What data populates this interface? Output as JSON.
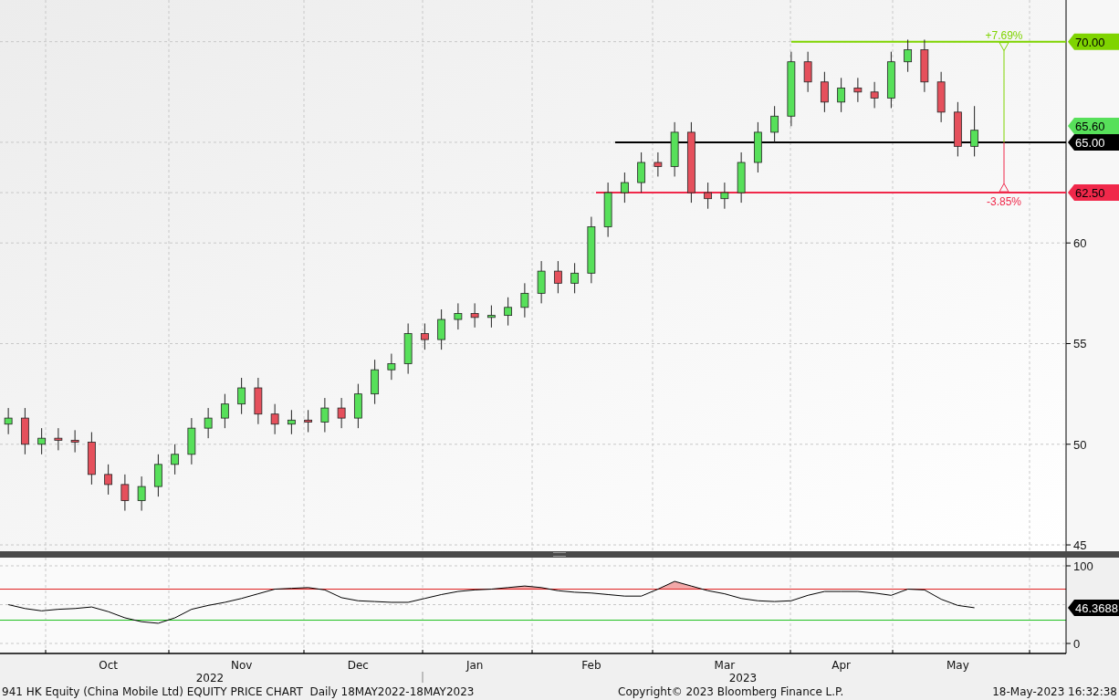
{
  "price_chart": {
    "chart_data": {
      "type": "candlestick",
      "ylim": [
        44.64,
        72.07
      ],
      "grid": true,
      "yticks": [
        45,
        50,
        55,
        60
      ],
      "categories": [
        null,
        null,
        null,
        null,
        null,
        null,
        null,
        null,
        null,
        null,
        null,
        null,
        null,
        null,
        null,
        null,
        null,
        null,
        null,
        null,
        null,
        null,
        null,
        null,
        null,
        null,
        null,
        null,
        null,
        null,
        null,
        null,
        null,
        null,
        null,
        null,
        null,
        null,
        null,
        null,
        null,
        null,
        null,
        null,
        null,
        null,
        null,
        null,
        null,
        null,
        null,
        null,
        null,
        null,
        null,
        null,
        null,
        null,
        null,
        null,
        null,
        null,
        null,
        null
      ],
      "ohlc": [
        [
          51,
          51.8,
          50.5,
          51.3
        ],
        [
          51.3,
          51.8,
          49.5,
          50
        ],
        [
          50,
          50.8,
          49.5,
          50.3
        ],
        [
          50.3,
          50.8,
          49.7,
          50.2
        ],
        [
          50.2,
          50.7,
          49.6,
          50.1
        ],
        [
          50.1,
          50.6,
          48,
          48.5
        ],
        [
          48.5,
          49,
          47.5,
          48
        ],
        [
          48,
          48.5,
          46.7,
          47.2
        ],
        [
          47.2,
          48.4,
          46.7,
          47.9
        ],
        [
          47.9,
          49.5,
          47.4,
          49
        ],
        [
          49,
          50,
          48.5,
          49.5
        ],
        [
          49.5,
          51.3,
          49,
          50.8
        ],
        [
          50.8,
          51.8,
          50.3,
          51.3
        ],
        [
          51.3,
          52.5,
          50.8,
          52
        ],
        [
          52,
          53.3,
          51.5,
          52.8
        ],
        [
          52.8,
          53.3,
          51,
          51.5
        ],
        [
          51.5,
          52,
          50.5,
          51
        ],
        [
          51,
          51.7,
          50.5,
          51.2
        ],
        [
          51.2,
          51.7,
          50.6,
          51.1
        ],
        [
          51.1,
          52.3,
          50.6,
          51.8
        ],
        [
          51.8,
          52.3,
          50.8,
          51.3
        ],
        [
          51.3,
          53,
          50.8,
          52.5
        ],
        [
          52.5,
          54.2,
          52,
          53.7
        ],
        [
          53.7,
          54.5,
          53.2,
          54
        ],
        [
          54,
          56,
          53.5,
          55.5
        ],
        [
          55.5,
          56,
          54.7,
          55.2
        ],
        [
          55.2,
          56.7,
          54.7,
          56.2
        ],
        [
          56.2,
          57,
          55.7,
          56.5
        ],
        [
          56.5,
          57,
          55.8,
          56.3
        ],
        [
          56.3,
          56.9,
          55.8,
          56.4
        ],
        [
          56.4,
          57.3,
          55.9,
          56.8
        ],
        [
          56.8,
          58,
          56.3,
          57.5
        ],
        [
          57.5,
          59.1,
          57,
          58.6
        ],
        [
          58.6,
          59.1,
          57.5,
          58
        ],
        [
          58,
          59,
          57.5,
          58.5
        ],
        [
          58.5,
          61.3,
          58,
          60.8
        ],
        [
          60.8,
          63,
          60.3,
          62.5
        ],
        [
          62.5,
          63.5,
          62,
          63
        ],
        [
          63,
          64.5,
          62.5,
          64
        ],
        [
          64,
          64.5,
          63.3,
          63.8
        ],
        [
          63.8,
          66,
          63.3,
          65.5
        ],
        [
          65.5,
          66,
          62,
          62.5
        ],
        [
          62.5,
          63,
          61.7,
          62.2
        ],
        [
          62.2,
          63,
          61.7,
          62.5
        ],
        [
          62.5,
          64.5,
          62,
          64
        ],
        [
          64,
          66,
          63.5,
          65.5
        ],
        [
          65.5,
          66.8,
          65,
          66.3
        ],
        [
          66.3,
          69.5,
          65.8,
          69
        ],
        [
          69,
          69.5,
          67.5,
          68
        ],
        [
          68,
          68.5,
          66.5,
          67
        ],
        [
          67,
          68.2,
          66.5,
          67.7
        ],
        [
          67.7,
          68.2,
          67,
          67.5
        ],
        [
          67.5,
          68,
          66.7,
          67.2
        ],
        [
          67.2,
          69.5,
          66.7,
          69
        ],
        [
          69,
          70.1,
          68.5,
          69.6
        ],
        [
          69.6,
          70.1,
          67.5,
          68
        ],
        [
          68,
          68.5,
          66,
          66.5
        ],
        [
          66.5,
          67,
          64.3,
          64.8
        ],
        [
          64.8,
          66.8,
          64.3,
          65.6
        ],
        null,
        null,
        null,
        null,
        null
      ],
      "ref_lines": [
        {
          "axis": "y",
          "value": 70,
          "color": "#7fd400",
          "label": "70.00"
        },
        {
          "axis": "y",
          "value": 65,
          "color": "#000000",
          "label": "65.00"
        },
        {
          "axis": "y",
          "value": 62.5,
          "color": "#f0284a",
          "label": "62.50"
        }
      ],
      "annotations": [
        "+7.69%",
        "-3.85%"
      ]
    },
    "last_price_tag": {
      "label": "65.60",
      "color": "#57e05a"
    }
  },
  "rsi_chart": {
    "chart_data": {
      "type": "line",
      "ylim": [
        -12.9,
        110.6
      ],
      "grid": true,
      "yticks": [
        0,
        100
      ],
      "categories": [
        null,
        null,
        null,
        null,
        null,
        null,
        "Oct",
        null,
        null,
        null,
        null,
        null,
        null,
        null,
        "Nov",
        null,
        null,
        null,
        null,
        null,
        null,
        "Dec",
        null,
        null,
        null,
        null,
        null,
        null,
        "Jan",
        null,
        null,
        null,
        null,
        null,
        null,
        "Feb",
        null,
        null,
        null,
        null,
        null,
        null,
        null,
        "Mar",
        null,
        null,
        null,
        null,
        null,
        null,
        "Apr",
        null,
        null,
        null,
        null,
        null,
        null,
        "May",
        null,
        null,
        null,
        null,
        null,
        null
      ],
      "series": [
        {
          "color": "#000000",
          "values": [
            50,
            45,
            42,
            44,
            45,
            47,
            41,
            33,
            28,
            26,
            33,
            44,
            49,
            53,
            58,
            64,
            70,
            71,
            72,
            69,
            59,
            55,
            54,
            53,
            53,
            58,
            63,
            67,
            69,
            70,
            72,
            74,
            72,
            68,
            66,
            65,
            63,
            61,
            61,
            70,
            80,
            74,
            68,
            64,
            58,
            55,
            54,
            55,
            62,
            67,
            67,
            67,
            65,
            62,
            70,
            69,
            57,
            49,
            46,
            null,
            null,
            null,
            null,
            null
          ]
        }
      ],
      "ref_lines": [
        {
          "axis": "y",
          "value": 70,
          "color": "#e02020"
        },
        {
          "axis": "y",
          "value": 30,
          "color": "#20c020"
        }
      ]
    },
    "value_tag": {
      "label": "46.3688",
      "color": "#000000"
    }
  },
  "time_axis": {
    "years": [
      "2022",
      "2023"
    ]
  },
  "footer": {
    "title": "941 HK Equity (China Mobile Ltd) EQUITY PRICE CHART  Daily 18MAY2022-18MAY2023",
    "copyright": "Copyright© 2023 Bloomberg Finance L.P.",
    "timestamp": "18-May-2023 16:32:38"
  }
}
